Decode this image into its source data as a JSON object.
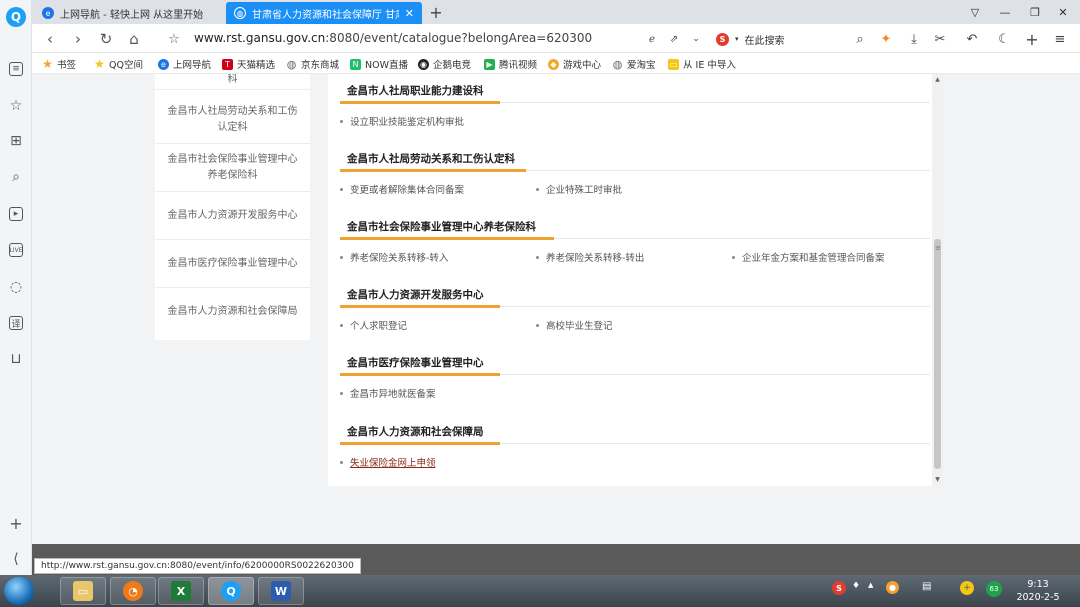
{
  "browser": {
    "tabs": [
      {
        "label": "上网导航 - 轻快上网 从这里开始",
        "icon": "browser-e-icon"
      },
      {
        "label": "甘肃省人力资源和社会保障厅 甘肃人",
        "icon": "globe-icon",
        "active": true,
        "close": "✕"
      }
    ],
    "new_tab": "+",
    "url_host": "www.rst.gansu.gov.cn",
    "url_rest": ":8080/event/catalogue?belongArea=620300",
    "search_placeholder": "在此搜索",
    "search_badge": "S",
    "bookmarks": [
      {
        "label": "书签",
        "icon": "star-icon",
        "color": "#f5a623"
      },
      {
        "label": "QQ空间",
        "icon": "star-icon",
        "color": "#f5c518"
      },
      {
        "label": "上网导航",
        "icon": "browser-e-icon",
        "color": "#1b74e8"
      },
      {
        "label": "天猫精选",
        "icon": "tmall-icon",
        "color": "#d0021b"
      },
      {
        "label": "京东商城",
        "icon": "globe-icon",
        "color": "#666666"
      },
      {
        "label": "NOW直播",
        "icon": "now-icon",
        "color": "#1fbf6b"
      },
      {
        "label": "企鹅电竞",
        "icon": "penguin-icon",
        "color": "#222222"
      },
      {
        "label": "腾讯视频",
        "icon": "play-icon",
        "color": "#21b04b"
      },
      {
        "label": "游戏中心",
        "icon": "gamepad-icon",
        "color": "#f5a623"
      },
      {
        "label": "爱淘宝",
        "icon": "globe-icon",
        "color": "#666666"
      },
      {
        "label": "从 IE 中导入",
        "icon": "folder-icon",
        "color": "#f5c518"
      }
    ]
  },
  "sidebar_departments": [
    "科",
    "金昌市人社局劳动关系和工伤认定科",
    "金昌市社会保险事业管理中心养老保险科",
    "金昌市人力资源开发服务中心",
    "金昌市医疗保险事业管理中心",
    "金昌市人力资源和社会保障局"
  ],
  "sections": [
    {
      "title": "金昌市人社局职业能力建设科",
      "items": [
        "设立职业技能鉴定机构审批"
      ]
    },
    {
      "title": "金昌市人社局劳动关系和工伤认定科",
      "items": [
        "变更或者解除集体合同备案",
        "企业特殊工时审批"
      ]
    },
    {
      "title": "金昌市社会保险事业管理中心养老保险科",
      "items": [
        "养老保险关系转移-转入",
        "养老保险关系转移-转出",
        "企业年金方案和基金管理合同备案"
      ]
    },
    {
      "title": "金昌市人力资源开发服务中心",
      "items": [
        "个人求职登记",
        "高校毕业生登记"
      ]
    },
    {
      "title": "金昌市医疗保险事业管理中心",
      "items": [
        "金昌市异地就医备案"
      ]
    },
    {
      "title": "金昌市人力资源和社会保障局",
      "items": [
        "失业保险金网上申领"
      ]
    }
  ],
  "status_url": "http://www.rst.gansu.gov.cn:8080/event/info/6200000RS0022620300",
  "taskbar": {
    "time": "9:13",
    "date": "2020-2-5",
    "tray_badge": "63",
    "input_badge": "S"
  },
  "colors": {
    "accent_orange": "#f0a22e",
    "tab_active": "#1b8ff6",
    "link_hover": "#8a2b1b"
  }
}
